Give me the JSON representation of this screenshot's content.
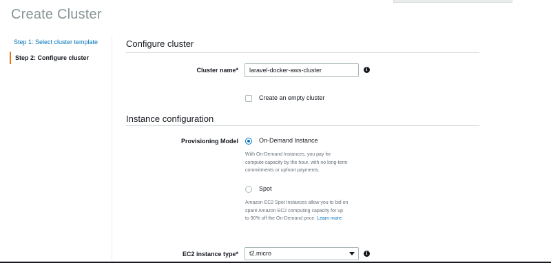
{
  "page": {
    "title": "Create Cluster"
  },
  "steps": [
    {
      "label": "Step 1: Select cluster template"
    },
    {
      "label": "Step 2: Configure cluster"
    }
  ],
  "configure": {
    "section_title": "Configure cluster",
    "cluster_name_label": "Cluster name*",
    "cluster_name_value": "laravel-docker-aws-cluster",
    "empty_cluster_label": "Create an empty cluster"
  },
  "instance": {
    "section_title": "Instance configuration",
    "provisioning_label": "Provisioning Model",
    "on_demand_label": "On-Demand Instance",
    "on_demand_desc_1": "With On-Demand Instances, you pay for",
    "on_demand_desc_2": "compute capacity by the hour, with no long-term",
    "on_demand_desc_3": "commitments or upfront payments.",
    "spot_label": "Spot",
    "spot_desc_1": "Amazon EC2 Spot Instances allow you to bid on",
    "spot_desc_2": "spare Amazon EC2 computing capacity for up",
    "spot_desc_3": "to 90% off the On-Demand price.",
    "learn_more": "Learn more",
    "ec2_type_label": "EC2 instance type*",
    "ec2_type_value": "t2.micro"
  },
  "icons": {
    "info": "info-icon",
    "caret": "chevron-down-icon"
  },
  "colors": {
    "link": "#0073bb",
    "active_step_accent": "#ec7211",
    "title_gray": "#879596"
  }
}
